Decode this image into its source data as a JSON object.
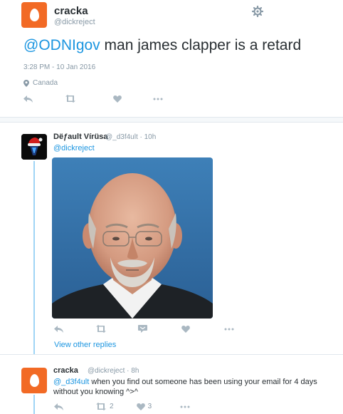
{
  "main_tweet": {
    "name": "cracka",
    "handle": "@dickreject",
    "mention": "@ODNIgov",
    "text": " man james clapper is a retard",
    "timestamp": "3:28 PM - 10 Jan 2016",
    "location": "Canada",
    "icons": [
      "gear-icon",
      "reply-icon",
      "retweet-icon",
      "like-icon",
      "more-icon"
    ]
  },
  "reply1": {
    "name": "Dëƒault Vírüsa",
    "meta": "@_d3f4ult · 10h",
    "mention": "@dickreject",
    "icons": [
      "reply-icon",
      "retweet-icon",
      "dm-icon",
      "like-icon",
      "more-icon"
    ]
  },
  "view_other_replies": "View other replies",
  "reply2": {
    "name": "cracka",
    "meta": "@dickreject · 8h",
    "mention": "@_d3f4ult",
    "text": " when you find out someone has been using your email for 4 days without you knowing ^>^",
    "retweet_count": "2",
    "like_count": "3"
  },
  "colors": {
    "accent": "#1b95e0",
    "egg_avatar": "#f26a25",
    "thread_line": "#9fd4f5",
    "muted": "#8899a6"
  }
}
